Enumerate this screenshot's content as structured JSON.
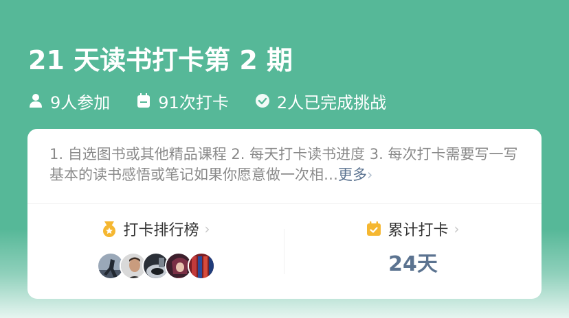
{
  "activity": {
    "title": "21 天读书打卡第 2 期",
    "stats": {
      "participants": "9人参加",
      "checkins": "91次打卡",
      "completed": "2人已完成挑战"
    }
  },
  "description": {
    "text": "1. 自选图书或其他精品课程 2. 每天打卡读书进度 3. 每次打卡需要写一写基本的读书感悟或笔记如果你愿意做一次相…",
    "more_label": "更多"
  },
  "ranking": {
    "label": "打卡排行榜",
    "avatars": [
      "avatar-1",
      "avatar-2",
      "avatar-3",
      "avatar-4",
      "avatar-5"
    ]
  },
  "cumulative": {
    "label": "累计打卡",
    "value": "24天"
  },
  "colors": {
    "header_bg": "#56b898",
    "accent": "#5b7390",
    "medal": "#f5b731"
  }
}
